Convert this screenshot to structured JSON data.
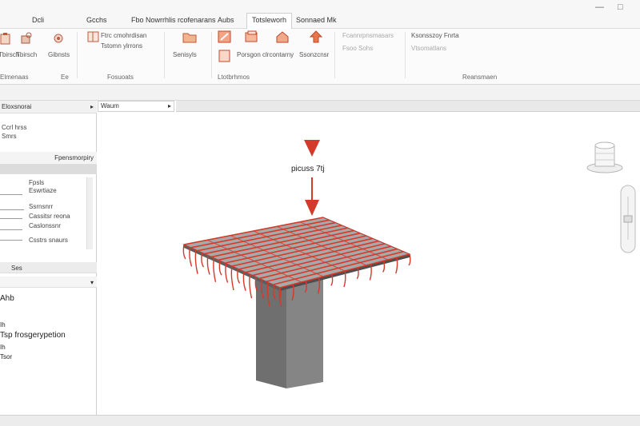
{
  "tabs": [
    {
      "label": "Dcli",
      "active": false
    },
    {
      "label": "Gcchs",
      "active": false
    },
    {
      "label": "Fbo",
      "active": false
    },
    {
      "label": "Nowrrhlis rcofenarans",
      "active": false
    },
    {
      "label": "Aubs",
      "active": false
    },
    {
      "label": "Totsleworh",
      "active": true
    },
    {
      "label": "Sonnaed Mk",
      "active": false
    }
  ],
  "ribbon": {
    "buttons": [
      {
        "label": "Tbirsch",
        "icon": "clipboard-icon"
      },
      {
        "label": "Gibnsts",
        "icon": "gear-cube-icon"
      },
      {
        "label": "Ftrc cmohrdisan",
        "icon": "frame-icon"
      },
      {
        "label": "Senisyls",
        "icon": "folder-icon"
      },
      {
        "label": "Porsgon clrcontarny",
        "icon": "edit-pencil-icon"
      },
      {
        "label": "Ssonzcnsr",
        "icon": "house-icon"
      },
      {
        "label": "Ksonsszoy Fnrta",
        "icon": "arrow-up-icon"
      }
    ],
    "disabled": [
      "Fcannrpnsmasars",
      "Fsoo Sohs",
      "Vtsomatlans"
    ],
    "extra_label": "Tstomn ylrrons",
    "groups": [
      "Elmenaas",
      "Ee",
      "Fosuoats",
      "Ltotbrhmos",
      "Reansmaen"
    ]
  },
  "left_panel": {
    "header1": "Eloxsnorai",
    "rows_top": [
      "Ccrl hrss",
      "Smrs"
    ],
    "header2": "Fpensmorpiry",
    "property_rows": [
      "Fpsls",
      "Eswrtiaze",
      "Ssrnsnrr",
      "Cassitsr reona",
      "Caslonssnr",
      "Csstrs snaurs"
    ],
    "section_tab": "Ses",
    "detail_items": [
      "Ahb",
      "Ih",
      "Tsp frosgerypetion",
      "Ih",
      "Tsor"
    ]
  },
  "viewport": {
    "tab_label": "Waum",
    "load_label": "picuss 7tj"
  },
  "colors": {
    "accent": "#d43a2a",
    "slab_gray": "#8a8a8a",
    "column_gray": "#6d6d6d"
  }
}
